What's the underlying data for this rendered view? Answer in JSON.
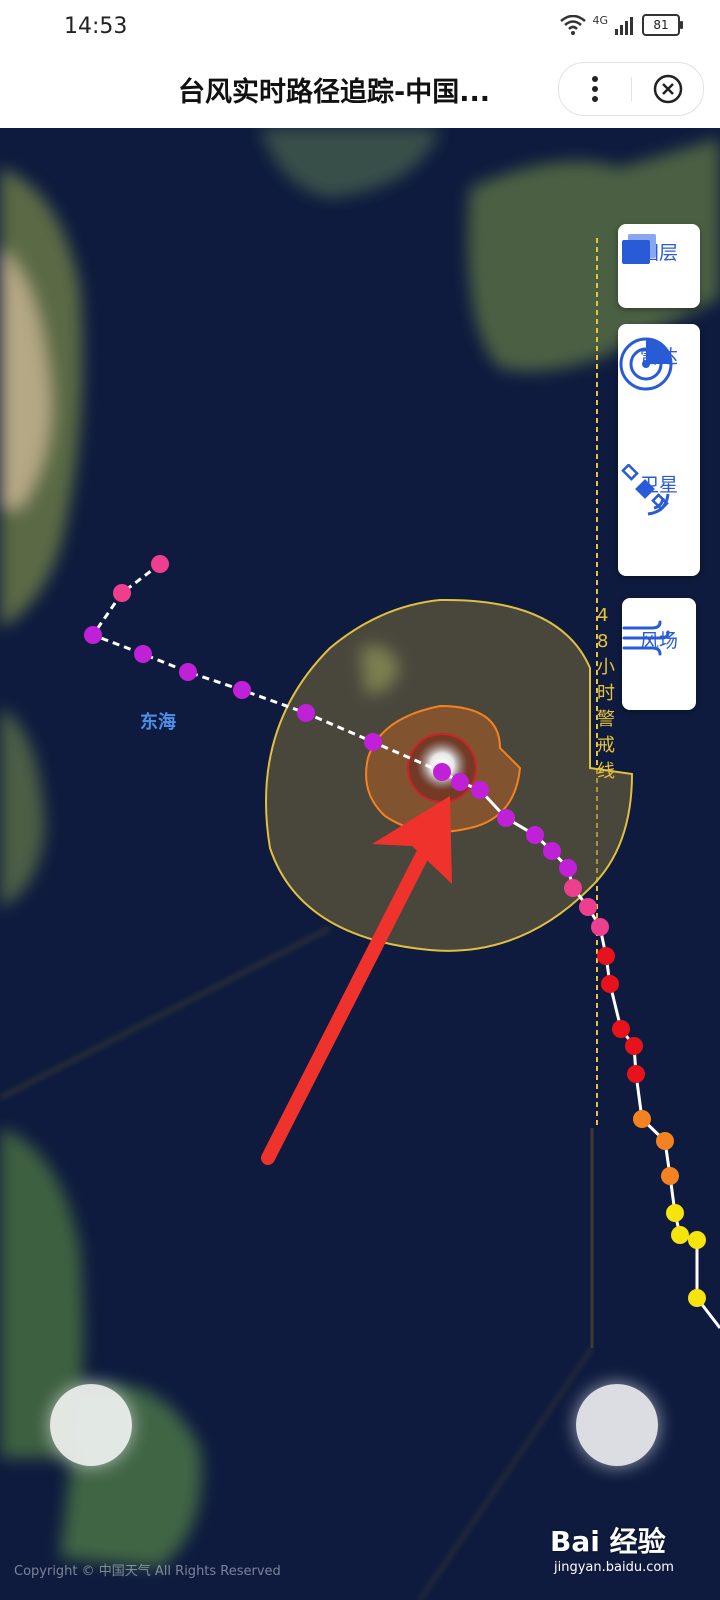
{
  "status_bar": {
    "time": "14:53",
    "network": "4G",
    "battery": "81"
  },
  "header": {
    "title": "台风实时路径追踪-中国..."
  },
  "map": {
    "sea_label": "东海",
    "warning_line_label": "48小时警戒线"
  },
  "side_tools": [
    {
      "label": "图层",
      "icon": "layers-icon"
    },
    {
      "label": "雷达",
      "icon": "radar-icon"
    },
    {
      "label": "卫星",
      "icon": "satellite-icon"
    },
    {
      "label": "风场",
      "icon": "wind-icon"
    }
  ],
  "colors": {
    "accent": "#2a5bd7",
    "warning_line": "#e8c33a",
    "track_purple": "#c020d8",
    "track_pink": "#ee3f8e",
    "track_red": "#e8121c",
    "track_orange": "#f58220",
    "track_yellow": "#f7e30e",
    "arrow": "#f0322d"
  },
  "watermark": {
    "main": "Bai 经验",
    "sub": "jingyan.baidu.com"
  },
  "copyright": "Copyright © 中国天气 All Rights Reserved"
}
